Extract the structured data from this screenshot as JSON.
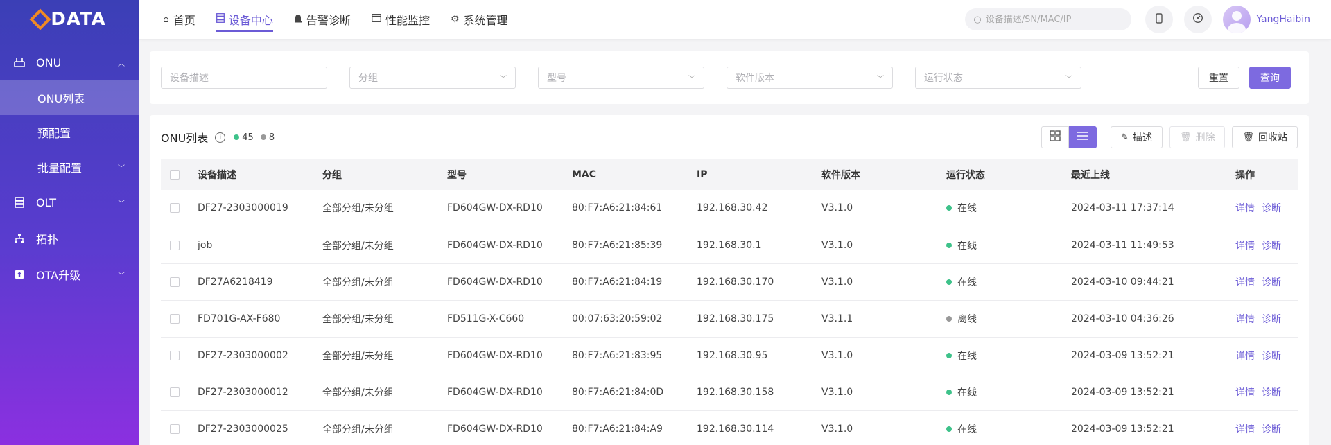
{
  "brand": {
    "logo_text": "DATA"
  },
  "sidebar": {
    "groups": [
      {
        "label": "ONU",
        "icon": "onu-icon",
        "expanded": true,
        "children": [
          {
            "label": "ONU列表",
            "active": true
          },
          {
            "label": "预配置"
          },
          {
            "label": "批量配置",
            "has_children": true
          }
        ]
      },
      {
        "label": "OLT",
        "icon": "olt-icon",
        "has_children": true
      },
      {
        "label": "拓扑",
        "icon": "topology-icon"
      },
      {
        "label": "OTA升级",
        "icon": "ota-upgrade-icon",
        "has_children": true
      }
    ]
  },
  "topnav": {
    "items": [
      {
        "label": "首页",
        "icon": "home-icon"
      },
      {
        "label": "设备中心",
        "icon": "device-icon",
        "active": true
      },
      {
        "label": "告警诊断",
        "icon": "alarm-icon"
      },
      {
        "label": "性能监控",
        "icon": "monitor-icon"
      },
      {
        "label": "系统管理",
        "icon": "settings-icon"
      }
    ],
    "search_placeholder": "设备描述/SN/MAC/IP",
    "username": "YangHaibin"
  },
  "filters": {
    "device_desc_placeholder": "设备描述",
    "group_placeholder": "分组",
    "model_placeholder": "型号",
    "software_placeholder": "软件版本",
    "status_placeholder": "运行状态",
    "reset_label": "重置",
    "query_label": "查询"
  },
  "table": {
    "title": "ONU列表",
    "online_count": "45",
    "offline_count": "8",
    "describe_label": "描述",
    "delete_label": "删除",
    "recycle_label": "回收站",
    "columns": [
      "设备描述",
      "分组",
      "型号",
      "MAC",
      "IP",
      "软件版本",
      "运行状态",
      "最近上线",
      "操作"
    ],
    "detail_label": "详情",
    "diagnose_label": "诊断",
    "rows": [
      {
        "desc": "DF27-2303000019",
        "group": "全部分组/未分组",
        "model": "FD604GW-DX-RD10",
        "mac": "80:F7:A6:21:84:61",
        "ip": "192.168.30.42",
        "version": "V3.1.0",
        "status": "在线",
        "online": true,
        "last": "2024-03-11 17:37:14"
      },
      {
        "desc": "job",
        "group": "全部分组/未分组",
        "model": "FD604GW-DX-RD10",
        "mac": "80:F7:A6:21:85:39",
        "ip": "192.168.30.1",
        "version": "V3.1.0",
        "status": "在线",
        "online": true,
        "last": "2024-03-11 11:49:53"
      },
      {
        "desc": "DF27A6218419",
        "group": "全部分组/未分组",
        "model": "FD604GW-DX-RD10",
        "mac": "80:F7:A6:21:84:19",
        "ip": "192.168.30.170",
        "version": "V3.1.0",
        "status": "在线",
        "online": true,
        "last": "2024-03-10 09:44:21"
      },
      {
        "desc": "FD701G-AX-F680",
        "group": "全部分组/未分组",
        "model": "FD511G-X-C660",
        "mac": "00:07:63:20:59:02",
        "ip": "192.168.30.175",
        "version": "V3.1.1",
        "status": "离线",
        "online": false,
        "last": "2024-03-10 04:36:26"
      },
      {
        "desc": "DF27-2303000002",
        "group": "全部分组/未分组",
        "model": "FD604GW-DX-RD10",
        "mac": "80:F7:A6:21:83:95",
        "ip": "192.168.30.95",
        "version": "V3.1.0",
        "status": "在线",
        "online": true,
        "last": "2024-03-09 13:52:21"
      },
      {
        "desc": "DF27-2303000012",
        "group": "全部分组/未分组",
        "model": "FD604GW-DX-RD10",
        "mac": "80:F7:A6:21:84:0D",
        "ip": "192.168.30.158",
        "version": "V3.1.0",
        "status": "在线",
        "online": true,
        "last": "2024-03-09 13:52:21"
      },
      {
        "desc": "DF27-2303000025",
        "group": "全部分组/未分组",
        "model": "FD604GW-DX-RD10",
        "mac": "80:F7:A6:21:84:A9",
        "ip": "192.168.30.114",
        "version": "V3.1.0",
        "status": "在线",
        "online": true,
        "last": "2024-03-09 13:52:21"
      }
    ]
  },
  "colors": {
    "accent": "#7d6ae0",
    "online": "#3ec28a",
    "offline": "#999999"
  }
}
